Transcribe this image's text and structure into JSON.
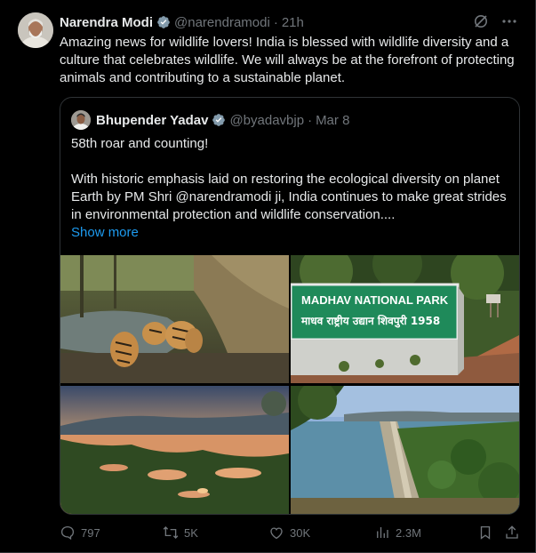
{
  "tweet": {
    "author_name": "Narendra Modi",
    "handle": "@narendramodi",
    "separator": "·",
    "time": "21h",
    "text": "Amazing news for wildlife lovers! India is blessed with wildlife diversity and a culture that celebrates wildlife. We will always be at the forefront of protecting animals and contributing to a sustainable planet."
  },
  "quoted": {
    "author_name": "Bhupender Yadav",
    "handle": "@byadavbjp",
    "separator": "·",
    "date": "Mar 8",
    "line1": "58th roar and counting!",
    "line2": "With historic emphasis laid on restoring the ecological diversity on planet Earth by PM Shri @narendramodi ji, India continues to make great strides in environmental protection and wildlife conservation....",
    "show_more": "Show more",
    "images": [
      {
        "icon": "tigers-photo"
      },
      {
        "icon": "madhav-national-park-sign-photo",
        "sign_line1": "MADHAV NATIONAL PARK",
        "sign_line2": "माधव राष्ट्रीय उद्यान शिवपुरी 1958"
      },
      {
        "icon": "lake-sunset-photo"
      },
      {
        "icon": "dam-photo"
      }
    ]
  },
  "actions": {
    "replies": "797",
    "reposts": "5K",
    "likes": "30K",
    "views": "2.3M"
  },
  "colors": {
    "background": "#000000",
    "text": "#e7e9ea",
    "muted": "#71767b",
    "link": "#1d9bf0",
    "verified": "#829aab",
    "border": "#2f3336"
  }
}
